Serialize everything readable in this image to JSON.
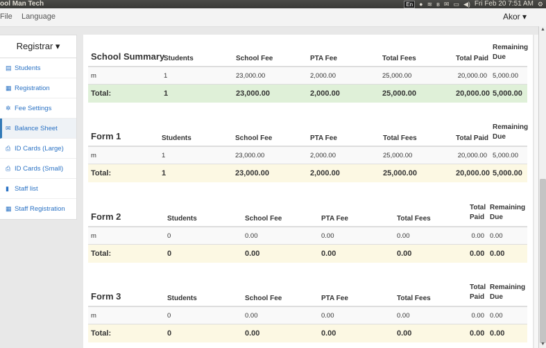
{
  "os": {
    "app_title": "ool Man Tech",
    "kb": "En",
    "date_time": "Fri Feb 20  7:51 AM"
  },
  "menubar": {
    "file": "File",
    "language": "Language",
    "user": "Akor ▾"
  },
  "sidebar": {
    "role": "Registrar ▾",
    "items": [
      {
        "label": "Students",
        "icon": "list-icon"
      },
      {
        "label": "Registration",
        "icon": "form-icon"
      },
      {
        "label": "Fee Settings",
        "icon": "gear-icon"
      },
      {
        "label": "Balance Sheet",
        "icon": "envelope-icon"
      },
      {
        "label": "ID Cards (Large)",
        "icon": "print-icon"
      },
      {
        "label": "ID Cards (Small)",
        "icon": "print-icon"
      },
      {
        "label": "Staff list",
        "icon": "book-icon"
      },
      {
        "label": "Staff Registration",
        "icon": "form-icon"
      }
    ]
  },
  "columns": {
    "students": "Students",
    "school_fee": "School Fee",
    "pta_fee": "PTA Fee",
    "total_fees": "Total Fees",
    "total_paid": "Total Paid",
    "remaining_due": "Remaining Due"
  },
  "summary": {
    "title": "School Summary",
    "row": {
      "name": "m",
      "students": "1",
      "school_fee": "23,000.00",
      "pta_fee": "2,000.00",
      "total_fees": "25,000.00",
      "total_paid": "20,000.00",
      "remaining": "5,000.00"
    },
    "total": {
      "label": "Total:",
      "students": "1",
      "school_fee": "23,000.00",
      "pta_fee": "2,000.00",
      "total_fees": "25,000.00",
      "total_paid": "20,000.00",
      "remaining": "5,000.00"
    }
  },
  "form1": {
    "title": "Form 1",
    "row": {
      "name": "m",
      "students": "1",
      "school_fee": "23,000.00",
      "pta_fee": "2,000.00",
      "total_fees": "25,000.00",
      "total_paid": "20,000.00",
      "remaining": "5,000.00"
    },
    "total": {
      "label": "Total:",
      "students": "1",
      "school_fee": "23,000.00",
      "pta_fee": "2,000.00",
      "total_fees": "25,000.00",
      "total_paid": "20,000.00",
      "remaining": "5,000.00"
    }
  },
  "form2": {
    "title": "Form 2",
    "row": {
      "name": "m",
      "students": "0",
      "school_fee": "0.00",
      "pta_fee": "0.00",
      "total_fees": "0.00",
      "total_paid": "0.00",
      "remaining": "0.00"
    },
    "total": {
      "label": "Total:",
      "students": "0",
      "school_fee": "0.00",
      "pta_fee": "0.00",
      "total_fees": "0.00",
      "total_paid": "0.00",
      "remaining": "0.00"
    }
  },
  "form3": {
    "title": "Form 3",
    "row": {
      "name": "m",
      "students": "0",
      "school_fee": "0.00",
      "pta_fee": "0.00",
      "total_fees": "0.00",
      "total_paid": "0.00",
      "remaining": "0.00"
    },
    "total": {
      "label": "Total:",
      "students": "0",
      "school_fee": "0.00",
      "pta_fee": "0.00",
      "total_fees": "0.00",
      "total_paid": "0.00",
      "remaining": "0.00"
    }
  }
}
